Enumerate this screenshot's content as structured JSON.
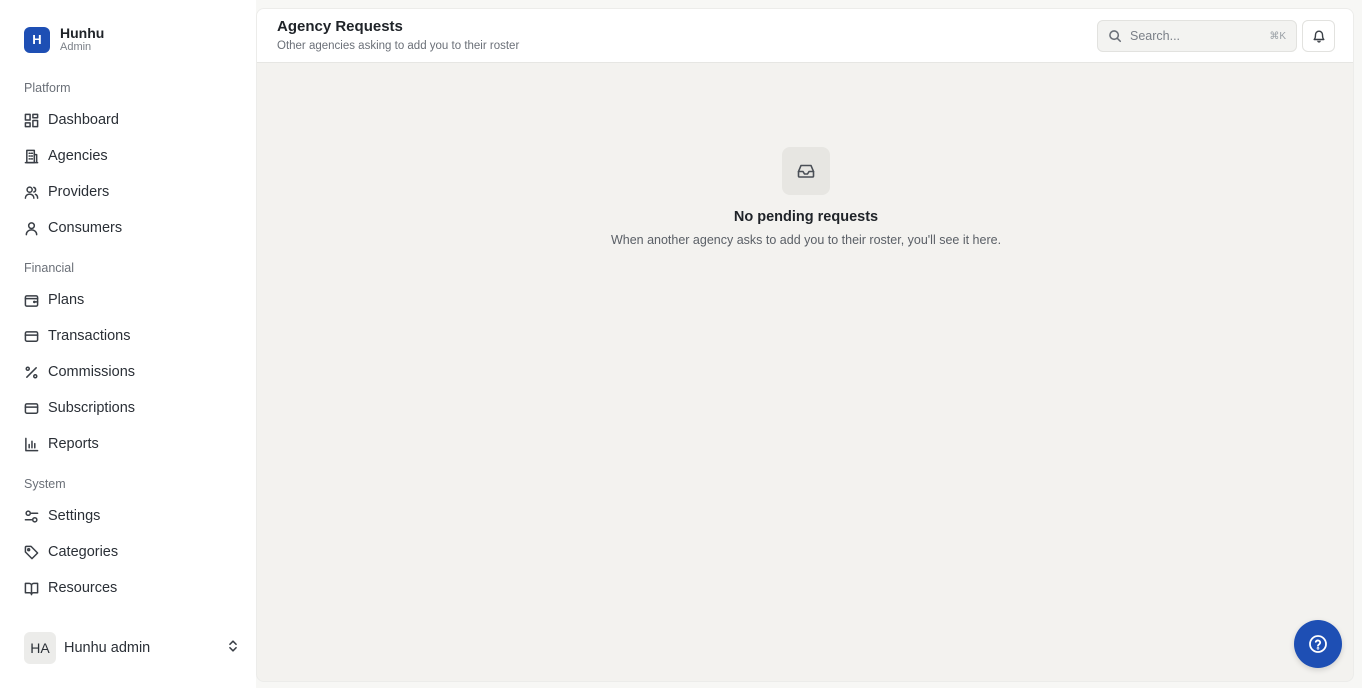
{
  "brand": {
    "initial": "H",
    "name": "Hunhu",
    "role": "Admin",
    "color": "#1e4fb4"
  },
  "sidebar": {
    "sections": [
      {
        "label": "Platform",
        "items": [
          {
            "label": "Dashboard",
            "icon": "dashboard-icon"
          },
          {
            "label": "Agencies",
            "icon": "building-icon"
          },
          {
            "label": "Providers",
            "icon": "users-icon"
          },
          {
            "label": "Consumers",
            "icon": "user-icon"
          }
        ]
      },
      {
        "label": "Financial",
        "items": [
          {
            "label": "Plans",
            "icon": "wallet-icon"
          },
          {
            "label": "Transactions",
            "icon": "credit-card-icon"
          },
          {
            "label": "Commissions",
            "icon": "percent-icon"
          },
          {
            "label": "Subscriptions",
            "icon": "credit-card-icon"
          },
          {
            "label": "Reports",
            "icon": "bar-chart-icon"
          }
        ]
      },
      {
        "label": "System",
        "items": [
          {
            "label": "Settings",
            "icon": "sliders-icon"
          },
          {
            "label": "Categories",
            "icon": "tag-icon"
          },
          {
            "label": "Resources",
            "icon": "book-icon"
          }
        ]
      }
    ]
  },
  "user": {
    "initials": "HA",
    "name": "Hunhu admin"
  },
  "header": {
    "title": "Agency Requests",
    "subtitle": "Other agencies asking to add you to their roster",
    "search_placeholder": "Search...",
    "search_shortcut": "⌘K"
  },
  "empty_state": {
    "title": "No pending requests",
    "description": "When another agency asks to add you to their roster, you'll see it here."
  }
}
